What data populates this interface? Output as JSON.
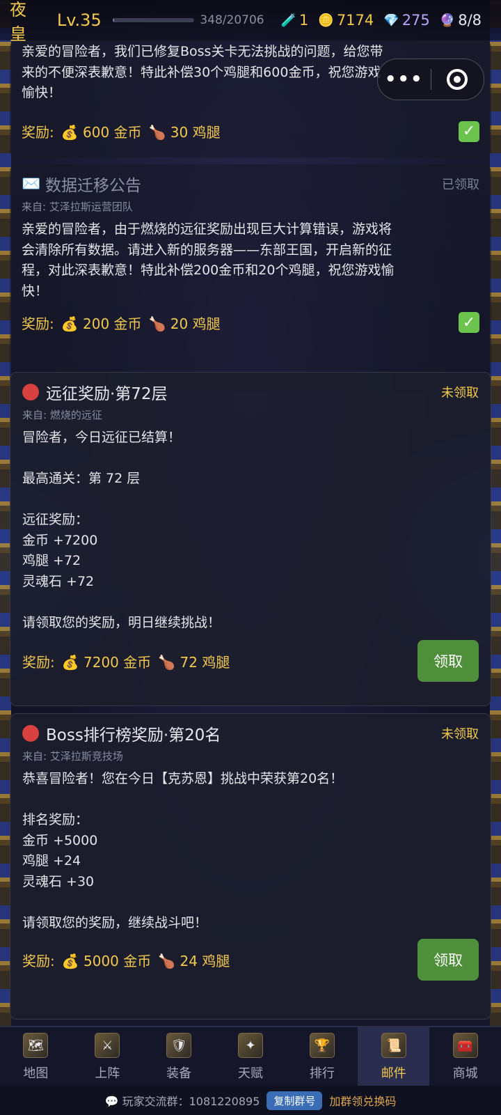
{
  "player": {
    "name": "夜皇",
    "level": "Lv.35",
    "xp_text": "348/20706",
    "xp_fraction": 0.017
  },
  "resources": {
    "potion": {
      "icon": "potion-icon",
      "value": "1"
    },
    "gold": {
      "icon": "gold-coin-icon",
      "value": "7174"
    },
    "diamond": {
      "icon": "diamond-icon",
      "value": "275"
    },
    "energy": {
      "icon": "purple-orb-icon",
      "value": "8/8"
    }
  },
  "mails": [
    {
      "title": "",
      "sender": "",
      "body": "亲爱的冒险者，我们已修复Boss关卡无法挑战的问题，给您带\n来的不便深表歉意！特此补偿30个鸡腿和600金币，祝您游戏\n愉快！",
      "reward_label": "奖励:",
      "rewards": [
        "💰 600 金币",
        "🍗 30 鸡腿"
      ],
      "status": ""
    },
    {
      "title": "数据迁移公告",
      "sender": "来自: 艾泽拉斯运营团队",
      "body": "亲爱的冒险者，由于燃烧的远征奖励出现巨大计算错误，游戏将\n会清除所有数据。请进入新的服务器——东部王国，开启新的征\n程，对此深表歉意！特此补偿200金币和20个鸡腿，祝您游戏愉\n快！",
      "reward_label": "奖励:",
      "rewards": [
        "💰 200 金币",
        "🍗 20 鸡腿"
      ],
      "status": "已领取"
    },
    {
      "title": "远征奖励·第72层",
      "sender": "来自: 燃烧的远征",
      "body": "冒险者，今日远征已结算！\n\n最高通关：第 72 层\n\n远征奖励：\n金币 +7200\n鸡腿 +72\n灵魂石 +72\n\n请领取您的奖励，明日继续挑战！",
      "reward_label": "奖励:",
      "rewards": [
        "💰 7200 金币",
        "🍗 72 鸡腿"
      ],
      "status": "未领取",
      "button": "领取"
    },
    {
      "title": "Boss排行榜奖励·第20名",
      "sender": "来自: 艾泽拉斯竞技场",
      "body": "恭喜冒险者！您在今日【克苏恩】挑战中荣获第20名！\n\n排名奖励：\n金币 +5000\n鸡腿 +24\n灵魂石 +30\n\n请领取您的奖励，继续战斗吧！",
      "reward_label": "奖励:",
      "rewards": [
        "💰 5000 金币",
        "🍗 24 鸡腿"
      ],
      "status": "未领取",
      "button": "领取"
    }
  ],
  "nav": [
    {
      "label": "地图",
      "icon": "map-icon"
    },
    {
      "label": "上阵",
      "icon": "crossed-swords-icon"
    },
    {
      "label": "装备",
      "icon": "equipment-icon"
    },
    {
      "label": "天赋",
      "icon": "talent-icon"
    },
    {
      "label": "排行",
      "icon": "ranking-crest-icon"
    },
    {
      "label": "邮件",
      "icon": "mail-seal-icon",
      "active": true
    },
    {
      "label": "商城",
      "icon": "treasure-chest-icon"
    }
  ],
  "footer": {
    "group_text": "💬 玩家交流群：1081220895",
    "copy_button": "复制群号",
    "redeem_text": "加群领兑换码"
  },
  "colors": {
    "gold": "#f2c94c",
    "claim_green": "#4f8f3c",
    "check_green": "#6cc44f",
    "unread_red": "#d94040",
    "nav_bg": "#15162a"
  }
}
